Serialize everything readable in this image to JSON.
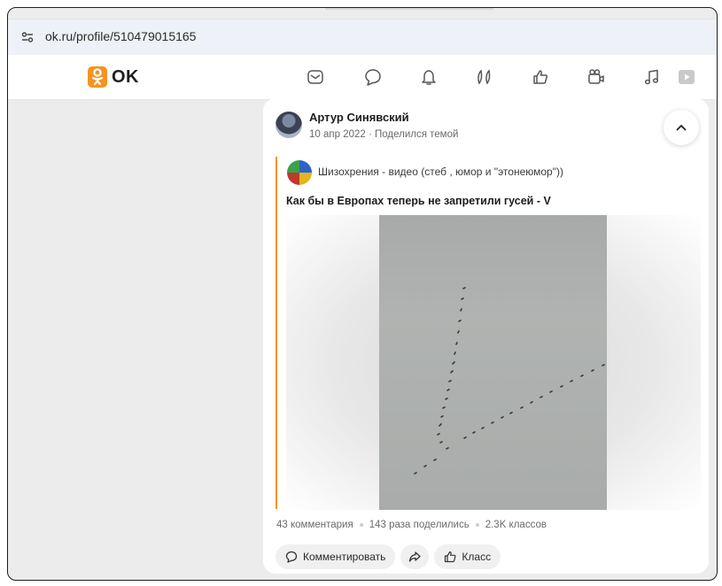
{
  "browser": {
    "url": "ok.ru/profile/510479015165"
  },
  "header": {
    "logo_text": "OK",
    "nav": [
      "mail-icon",
      "chat-icon",
      "bell-icon",
      "guests-icon",
      "likes-icon",
      "video-icon",
      "music-icon",
      "play-icon"
    ]
  },
  "colors": {
    "brand": "#f7931e",
    "page_bg": "#ececec"
  },
  "post": {
    "author": "Артур Синявский",
    "meta": "10 апр 2022 · Поделился темой",
    "group": "Шизохрения - видео (стеб , юмор и \"этонеюмор\"))",
    "title": "Как бы в Европах теперь не запретили гусей - V",
    "stats": {
      "comments": "43 комментария",
      "shares": "143 раза поделились",
      "likes": "2.3K классов"
    },
    "actions": {
      "comment": "Комментировать",
      "like": "Класс"
    }
  }
}
